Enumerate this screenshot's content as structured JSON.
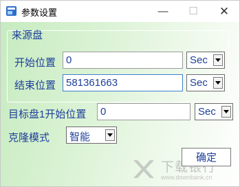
{
  "window": {
    "title": "参数设置",
    "icon": "app-settings-icon",
    "controls": {
      "minimize": "minimize-icon",
      "maximize": "maximize-icon",
      "close": "close-icon"
    }
  },
  "source_group": {
    "title": "来源盘",
    "start": {
      "label": "开始位置",
      "value": "0",
      "unit": "Sec"
    },
    "end": {
      "label": "结束位置",
      "value": "581361663",
      "unit": "Sec"
    }
  },
  "target": {
    "label": "目标盘1开始位置",
    "value": "0",
    "unit": "Sec"
  },
  "clone_mode": {
    "label": "克隆模式",
    "value": "智能"
  },
  "ok_label": "确定",
  "watermark": {
    "text": "下载银行",
    "url": "www.downbank.cn"
  },
  "colors": {
    "label_text": "#1e3f9a",
    "background_start": "#c6ebc0",
    "focus_border": "#3c7fd1"
  }
}
